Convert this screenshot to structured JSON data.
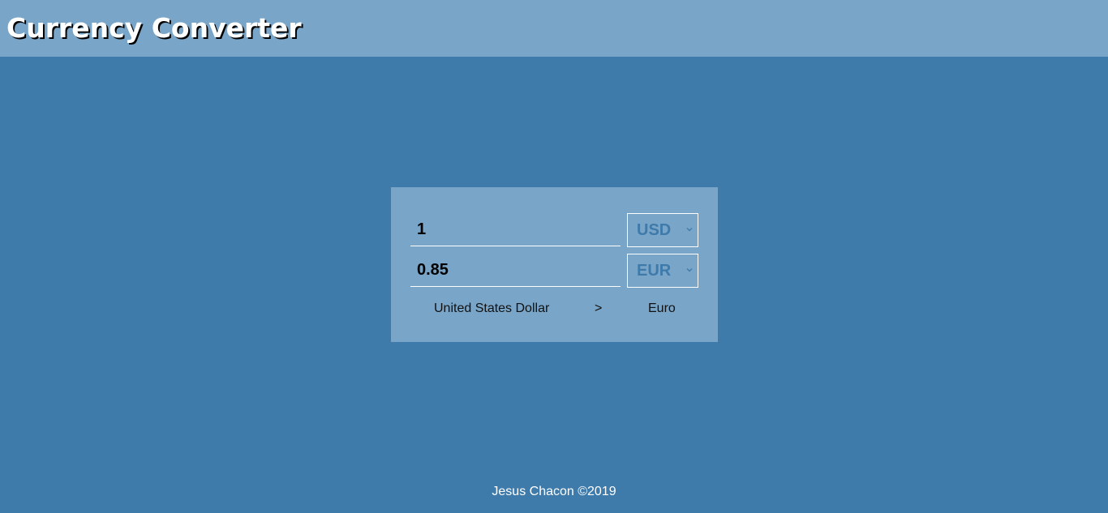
{
  "header": {
    "title": "Currency Converter"
  },
  "converter": {
    "from": {
      "amount": "1",
      "currency": "USD",
      "currency_name": "United States Dollar"
    },
    "to": {
      "amount": "0.85",
      "currency": "EUR",
      "currency_name": "Euro"
    },
    "direction_symbol": ">"
  },
  "footer": {
    "credit": "Jesus Chacon ©2019"
  },
  "colors": {
    "background": "#3e7bab",
    "panel": "#79a5c8",
    "select_text": "#3e7bab"
  },
  "icons": {
    "select_arrow": "chevron-down-icon"
  }
}
